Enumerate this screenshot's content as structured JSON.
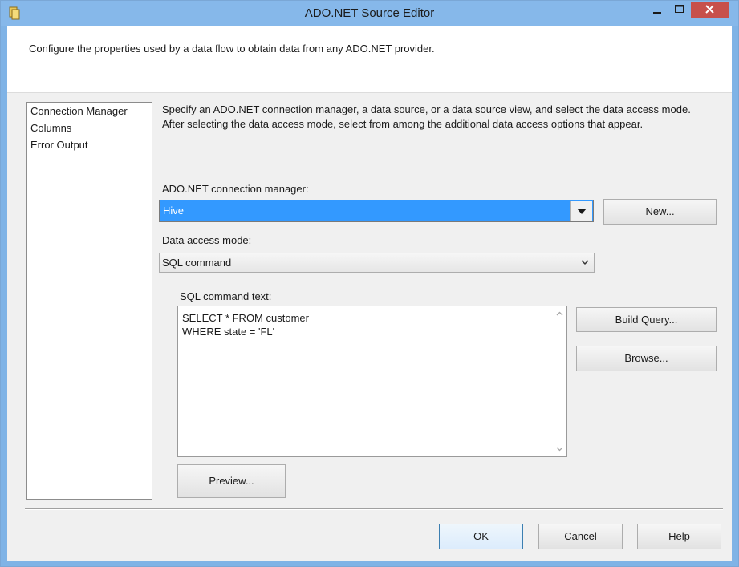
{
  "window": {
    "title": "ADO.NET Source Editor"
  },
  "header": {
    "description": "Configure the properties used by a data flow to obtain data from any ADO.NET provider."
  },
  "nav": {
    "items": [
      "Connection Manager",
      "Columns",
      "Error Output"
    ],
    "selected": "Connection Manager"
  },
  "main": {
    "instructions_line1": "Specify an ADO.NET connection manager, a data source, or a data source view, and select the data access mode.",
    "instructions_line2": "After selecting the data access mode, select from among the additional data access options that appear.",
    "connection_label": "ADO.NET connection manager:",
    "connection_value": "Hive",
    "new_button": "New...",
    "mode_label": "Data access mode:",
    "mode_value": "SQL command",
    "sql_label": "SQL command text:",
    "sql_text": "SELECT * FROM customer\nWHERE state = 'FL'",
    "build_query_button": "Build Query...",
    "browse_button": "Browse...",
    "preview_button": "Preview..."
  },
  "footer": {
    "ok_button": "OK",
    "cancel_button": "Cancel",
    "help_button": "Help"
  },
  "colors": {
    "titlebar": "#86b8ea",
    "close": "#c7504b",
    "selection": "#3399ff",
    "default_button_border": "#3c7fb1"
  },
  "icons": [
    "app-icon",
    "minimize-icon",
    "maximize-icon",
    "close-icon",
    "dropdown-arrow-icon",
    "chevron-down-icon",
    "scroll-up-icon",
    "scroll-down-icon"
  ]
}
